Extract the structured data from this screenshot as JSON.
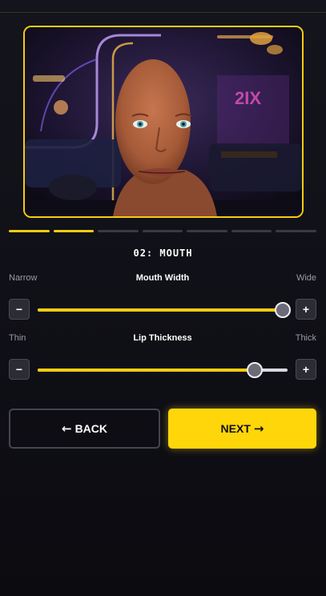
{
  "step": {
    "title": "02: MOUTH",
    "total": 7,
    "current": 2
  },
  "preview": {
    "alt": "character head preview",
    "frame_color": "#f5cc10"
  },
  "sliders": [
    {
      "name": "Mouth Width",
      "min_label": "Narrow",
      "max_label": "Wide",
      "value": 0.98,
      "minus": "−",
      "plus": "+"
    },
    {
      "name": "Lip Thickness",
      "min_label": "Thin",
      "max_label": "Thick",
      "value": 0.87,
      "minus": "−",
      "plus": "+"
    }
  ],
  "nav": {
    "back_label": "BACK",
    "back_arrow": "←",
    "next_label": "NEXT",
    "next_arrow": "→"
  },
  "colors": {
    "accent": "#ffd60a",
    "background": "#111118"
  }
}
